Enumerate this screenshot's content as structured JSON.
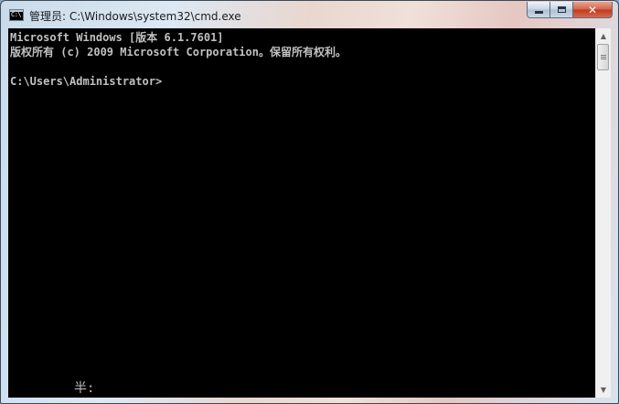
{
  "window": {
    "title": "管理员: C:\\Windows\\system32\\cmd.exe",
    "app_icon_text": "C:\\",
    "app_icon": "cmd-icon",
    "buttons": {
      "minimize_icon": "minimize-icon",
      "maximize_icon": "maximize-icon",
      "close_label": "✕"
    }
  },
  "console": {
    "lines": [
      "Microsoft Windows [版本 6.1.7601]",
      "版权所有 (c) 2009 Microsoft Corporation。保留所有权利。",
      "",
      "C:\\Users\\Administrator>"
    ],
    "ime_status": "半:",
    "text_color": "#c0c0c0",
    "background_color": "#000000"
  },
  "scrollbar": {
    "up_arrow": "▲",
    "down_arrow": "▼"
  }
}
